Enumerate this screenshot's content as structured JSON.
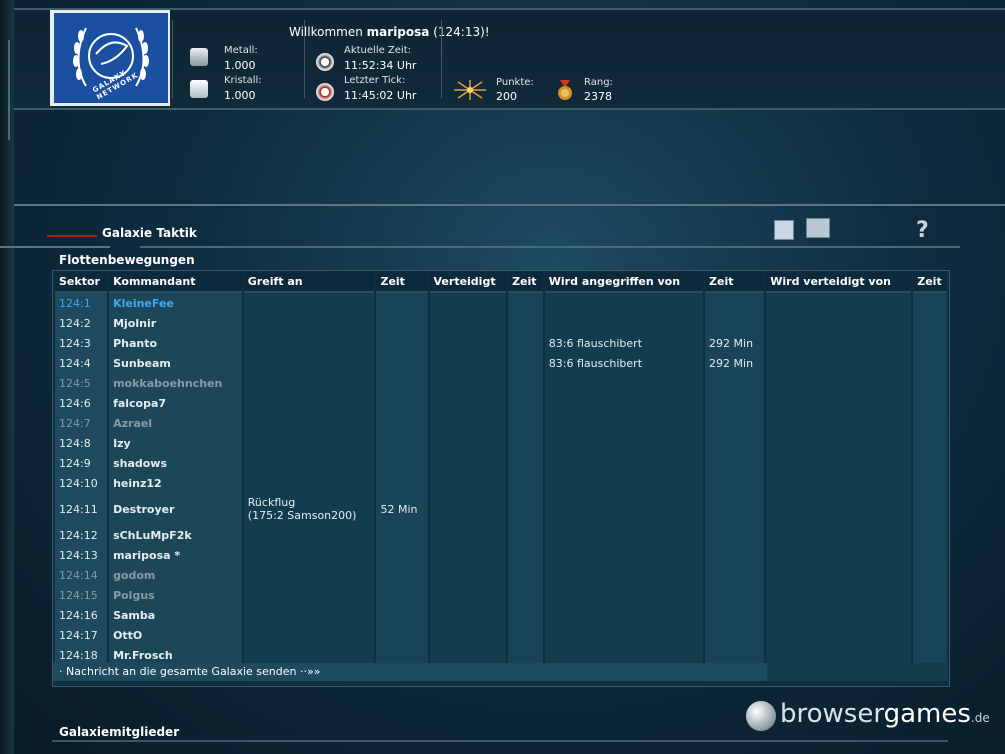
{
  "header": {
    "welcome_prefix": "Willkommen",
    "username": "mariposa",
    "coords": "(124:13)!",
    "logo_text": "GALAXY NETWORK",
    "metal_label": "Metall:",
    "metal_value": "1.000",
    "crystal_label": "Kristall:",
    "crystal_value": "1.000",
    "current_time_label": "Aktuelle Zeit:",
    "current_time_value": "11:52:34 Uhr",
    "last_tick_label": "Letzter Tick:",
    "last_tick_value": "11:45:02 Uhr",
    "points_label": "Punkte:",
    "points_value": "200",
    "rank_label": "Rang:",
    "rank_value": "2378"
  },
  "section": {
    "title": "Galaxie Taktik",
    "fleet_title": "Flottenbewegungen",
    "members_title": "Galaxiemitglieder",
    "help": "?"
  },
  "table": {
    "headers": [
      "Sektor",
      "Kommandant",
      "Greift an",
      "Zeit",
      "Verteidigt",
      "Zeit",
      "Wird angegriffen von",
      "Zeit",
      "Wird verteidigt von",
      "Zeit"
    ],
    "rows": [
      {
        "sektor": "124:1",
        "kommandant": "KleineFee",
        "greift": "",
        "zeit1": "",
        "verteidigt": "",
        "zeit2": "",
        "angegriffen": "",
        "zeit3": "",
        "verteidigt_von": "",
        "zeit4": ""
      },
      {
        "sektor": "124:2",
        "kommandant": "Mjolnir",
        "greift": "",
        "zeit1": "",
        "verteidigt": "",
        "zeit2": "",
        "angegriffen": "",
        "zeit3": "",
        "verteidigt_von": "",
        "zeit4": ""
      },
      {
        "sektor": "124:3",
        "kommandant": "Phanto",
        "greift": "",
        "zeit1": "",
        "verteidigt": "",
        "zeit2": "",
        "angegriffen": "83:6 flauschibert",
        "zeit3": "292 Min",
        "verteidigt_von": "",
        "zeit4": ""
      },
      {
        "sektor": "124:4",
        "kommandant": "Sunbeam",
        "greift": "",
        "zeit1": "",
        "verteidigt": "",
        "zeit2": "",
        "angegriffen": "83:6 flauschibert",
        "zeit3": "292 Min",
        "verteidigt_von": "",
        "zeit4": ""
      },
      {
        "sektor": "124:5",
        "kommandant": "mokkaboehnchen",
        "greift": "",
        "zeit1": "",
        "verteidigt": "",
        "zeit2": "",
        "angegriffen": "",
        "zeit3": "",
        "verteidigt_von": "",
        "zeit4": ""
      },
      {
        "sektor": "124:6",
        "kommandant": "falcopa7",
        "greift": "",
        "zeit1": "",
        "verteidigt": "",
        "zeit2": "",
        "angegriffen": "",
        "zeit3": "",
        "verteidigt_von": "",
        "zeit4": ""
      },
      {
        "sektor": "124:7",
        "kommandant": "Azrael",
        "greift": "",
        "zeit1": "",
        "verteidigt": "",
        "zeit2": "",
        "angegriffen": "",
        "zeit3": "",
        "verteidigt_von": "",
        "zeit4": ""
      },
      {
        "sektor": "124:8",
        "kommandant": "Izy",
        "greift": "",
        "zeit1": "",
        "verteidigt": "",
        "zeit2": "",
        "angegriffen": "",
        "zeit3": "",
        "verteidigt_von": "",
        "zeit4": ""
      },
      {
        "sektor": "124:9",
        "kommandant": "shadows",
        "greift": "",
        "zeit1": "",
        "verteidigt": "",
        "zeit2": "",
        "angegriffen": "",
        "zeit3": "",
        "verteidigt_von": "",
        "zeit4": ""
      },
      {
        "sektor": "124:10",
        "kommandant": "heinz12",
        "greift": "",
        "zeit1": "",
        "verteidigt": "",
        "zeit2": "",
        "angegriffen": "",
        "zeit3": "",
        "verteidigt_von": "",
        "zeit4": ""
      },
      {
        "sektor": "124:11",
        "kommandant": "Destroyer",
        "greift": "Rückflug",
        "greift2": "(175:2 Samson200)",
        "zeit1": "52 Min",
        "verteidigt": "",
        "zeit2": "",
        "angegriffen": "",
        "zeit3": "",
        "verteidigt_von": "",
        "zeit4": ""
      },
      {
        "sektor": "124:12",
        "kommandant": "sChLuMpF2k",
        "greift": "",
        "zeit1": "",
        "verteidigt": "",
        "zeit2": "",
        "angegriffen": "",
        "zeit3": "",
        "verteidigt_von": "",
        "zeit4": ""
      },
      {
        "sektor": "124:13",
        "kommandant": "mariposa *",
        "greift": "",
        "zeit1": "",
        "verteidigt": "",
        "zeit2": "",
        "angegriffen": "",
        "zeit3": "",
        "verteidigt_von": "",
        "zeit4": ""
      },
      {
        "sektor": "124:14",
        "kommandant": "godom",
        "greift": "",
        "zeit1": "",
        "verteidigt": "",
        "zeit2": "",
        "angegriffen": "",
        "zeit3": "",
        "verteidigt_von": "",
        "zeit4": ""
      },
      {
        "sektor": "124:15",
        "kommandant": "Polgus",
        "greift": "",
        "zeit1": "",
        "verteidigt": "",
        "zeit2": "",
        "angegriffen": "",
        "zeit3": "",
        "verteidigt_von": "",
        "zeit4": ""
      },
      {
        "sektor": "124:16",
        "kommandant": "Samba",
        "greift": "",
        "zeit1": "",
        "verteidigt": "",
        "zeit2": "",
        "angegriffen": "",
        "zeit3": "",
        "verteidigt_von": "",
        "zeit4": ""
      },
      {
        "sektor": "124:17",
        "kommandant": "OttO",
        "greift": "",
        "zeit1": "",
        "verteidigt": "",
        "zeit2": "",
        "angegriffen": "",
        "zeit3": "",
        "verteidigt_von": "",
        "zeit4": ""
      },
      {
        "sektor": "124:18",
        "kommandant": "Mr.Frosch",
        "greift": "",
        "zeit1": "",
        "verteidigt": "",
        "zeit2": "",
        "angegriffen": "",
        "zeit3": "",
        "verteidigt_von": "",
        "zeit4": ""
      }
    ],
    "self_row_index": 0,
    "inactive_row_indices": [
      4,
      6,
      13,
      14
    ]
  },
  "message_link": "· Nachricht an die gesamte Galaxie senden ··»»",
  "watermark": {
    "main": "browser",
    "accent": "games",
    "suffix": ".de"
  },
  "colors": {
    "self": "#3fa9f5",
    "inactive": "#8a9aa3",
    "accent_line": "#b01818"
  },
  "icons": [
    "metal-icon",
    "crystal-icon",
    "clock-icon",
    "tick-clock-icon",
    "points-icon",
    "rank-medal-icon",
    "edit-icon",
    "folder-icon",
    "help-icon"
  ]
}
